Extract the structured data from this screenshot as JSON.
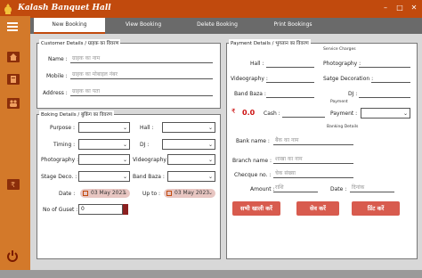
{
  "app": {
    "title": "Kalash Banquet Hall"
  },
  "tabs": [
    {
      "label": "New Booking",
      "active": true
    },
    {
      "label": "View Booking",
      "active": false
    },
    {
      "label": "Delete Booking",
      "active": false
    },
    {
      "label": "Print Bookings",
      "active": false
    }
  ],
  "colors": {
    "accent": "#c14a0d",
    "sidebar": "#d3792a",
    "button": "#d85b4e"
  },
  "customer": {
    "legend": "Customer Details / ग्राहक का विवरण",
    "name_label": "Name :",
    "name_placeholder": "ग्राहक का नाम",
    "mobile_label": "Mobile :",
    "mobile_placeholder": "ग्राहक का मोबाइल नंबर",
    "address_label": "Address :",
    "address_placeholder": "ग्राहक का पता"
  },
  "booking": {
    "legend": "Boking Details / बुकिंग का विवरण",
    "purpose_label": "Purpose :",
    "hall_label": "Hall :",
    "timing_label": "Timing :",
    "dj_label": "DJ :",
    "photography_label": "Photography :",
    "videography_label": "Videography :",
    "stage_label": "Stage Deco. :",
    "bandbaza_label": "Band Baza :",
    "date_label": "Date :",
    "date_value": "03 May 2023",
    "upto_label": "Up to :",
    "upto_value": "03 May 2023",
    "guests_label": "No of Guset :",
    "guests_value": "0"
  },
  "payment": {
    "legend": "Payment Details / भुगतान का विवरण",
    "service_charges": "Service Charges",
    "hall_label": "Hall :",
    "photography_label": "Photography :",
    "videography_label": "Videography :",
    "satge_label": "Satge Decoration :",
    "bandbaza_label": "Band Baza :",
    "dj_label": "DJ :",
    "payment_section": "Payment",
    "rupee": "₹",
    "total": "0.0",
    "cash_label": "Cash :",
    "payment_label": "Payment :",
    "banking_section": "Banking Details",
    "bankname_label": "Bank name :",
    "bankname_placeholder": "बैंक का नाम",
    "branch_label": "Branch name :",
    "branch_placeholder": "शाखा का नाम",
    "cheque_label": "Checque no. :",
    "cheque_placeholder": "चेक संख्या",
    "amount_label": "Amount :",
    "amount_placeholder": "राशि",
    "date_label": "Date :",
    "date_placeholder": "दिनांक"
  },
  "buttons": {
    "clear": "सभी खाली करें",
    "save": "सेव करें",
    "print": "प्रिंट करें"
  }
}
